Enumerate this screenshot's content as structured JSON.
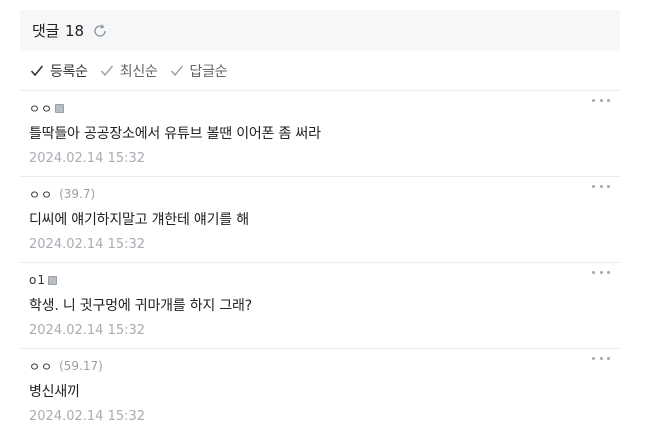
{
  "header": {
    "title": "댓글",
    "count": "18"
  },
  "sort": [
    {
      "label": "등록순",
      "active": true
    },
    {
      "label": "최신순",
      "active": false
    },
    {
      "label": "답글순",
      "active": false
    }
  ],
  "comments": [
    {
      "author": "ㅇㅇ",
      "score": "",
      "has_member_icon": true,
      "text": "틀딱들아 공공장소에서 유튜브 볼땐 이어폰 좀 써라",
      "date": "2024.02.14 15:32"
    },
    {
      "author": "ㅇㅇ",
      "score": "(39.7)",
      "has_member_icon": false,
      "text": "디씨에 얘기하지말고 걔한테 얘기를 해",
      "date": "2024.02.14 15:32"
    },
    {
      "author": "o1",
      "score": "",
      "has_member_icon": true,
      "text": "학생. 니 귓구멍에 귀마개를 하지 그래?",
      "date": "2024.02.14 15:32"
    },
    {
      "author": "ㅇㅇ",
      "score": "(59.17)",
      "has_member_icon": false,
      "text": "병신새끼",
      "date": "2024.02.14 15:32"
    }
  ],
  "colors": {
    "header_bg": "#f6f7f9",
    "divider": "#ececec",
    "date_text": "#a8adb3"
  },
  "icons": {
    "refresh": "refresh-icon",
    "check": "check-icon",
    "more": "more-dots-icon"
  }
}
